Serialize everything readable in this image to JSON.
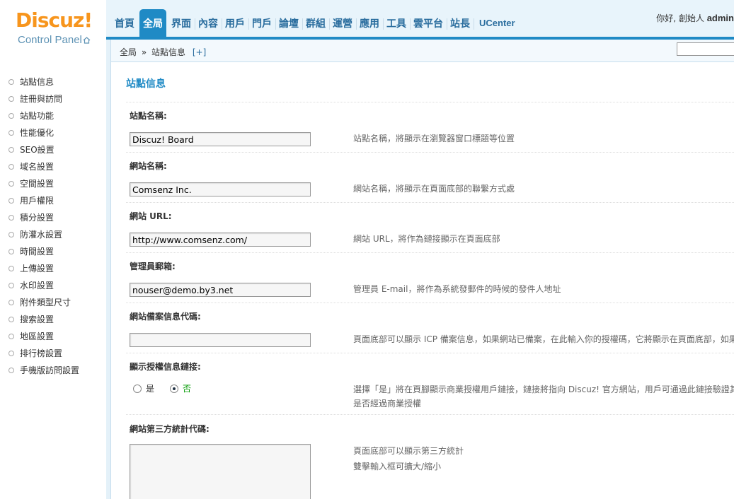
{
  "logo": {
    "brand": "Discuz!",
    "subtitle": "Control Panel"
  },
  "nav": {
    "items": [
      "首頁",
      "全局",
      "界面",
      "內容",
      "用戶",
      "門戶",
      "論壇",
      "群組",
      "運營",
      "應用",
      "工具",
      "雲平台",
      "站長",
      "UCenter"
    ],
    "active_index": 1
  },
  "user": {
    "greeting": "你好, 創始人",
    "name": "admin"
  },
  "breadcrumb": {
    "root": "全局",
    "separator": "»",
    "current": "站點信息",
    "add": "[+]"
  },
  "sidebar": {
    "items": [
      "站點信息",
      "註冊與訪問",
      "站點功能",
      "性能優化",
      "SEO設置",
      "域名設置",
      "空間設置",
      "用戶權限",
      "積分設置",
      "防灌水設置",
      "時間設置",
      "上傳設置",
      "水印設置",
      "附件類型尺寸",
      "搜索設置",
      "地區設置",
      "排行榜設置",
      "手機版訪問設置"
    ]
  },
  "main": {
    "title": "站點信息",
    "fields": [
      {
        "label": "站點名稱:",
        "value": "Discuz! Board",
        "tip": "站點名稱，將顯示在瀏覽器窗口標題等位置"
      },
      {
        "label": "網站名稱:",
        "value": "Comsenz Inc.",
        "tip": "網站名稱，將顯示在頁面底部的聯繫方式處"
      },
      {
        "label": "網站 URL:",
        "value": "http://www.comsenz.com/",
        "tip": "網站 URL，將作為鏈接顯示在頁面底部"
      },
      {
        "label": "管理員郵箱:",
        "value": "nouser@demo.by3.net",
        "tip": "管理員 E-mail，將作為系統發郵件的時候的發件人地址"
      },
      {
        "label": "網站備案信息代碼:",
        "value": "",
        "tip": "頁面底部可以顯示 ICP 備案信息，如果網站已備案，在此輸入你的授權碼，它將顯示在頁面底部，如果"
      }
    ],
    "license": {
      "label": "顯示授權信息鏈接:",
      "yes": "是",
      "no": "否",
      "selected": "否",
      "tip_line1": "選擇「是」將在頁腳顯示商業授權用戶鏈接，鏈接將指向 Discuz! 官方網站，用戶可通過此鏈接驗證其",
      "tip_line2": "是否經過商業授權"
    },
    "stats": {
      "label": "網站第三方統計代碼:",
      "tip_line1": "頁面底部可以顯示第三方統計",
      "tip_line2": "雙擊輸入框可擴大/縮小"
    }
  }
}
